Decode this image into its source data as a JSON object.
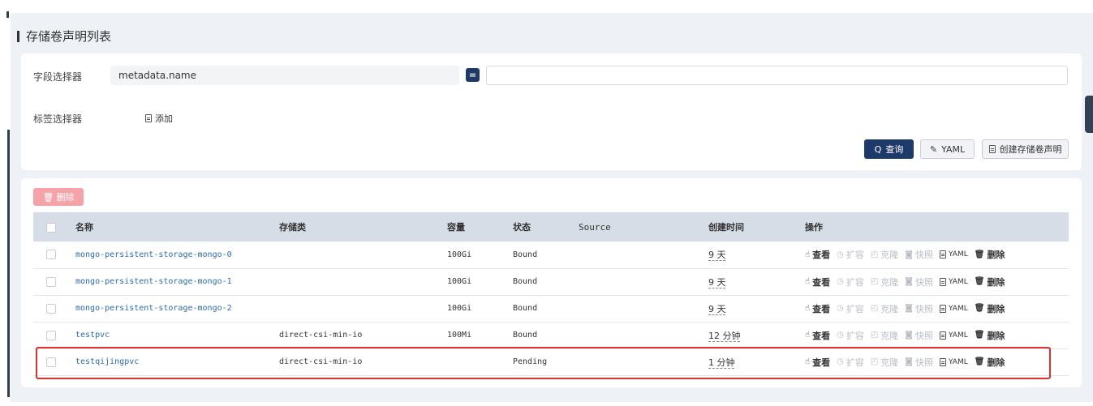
{
  "page": {
    "title": "存储卷声明列表"
  },
  "filters": {
    "field_selector_label": "字段选择器",
    "field_selector_value": "metadata.name",
    "operator": "=",
    "value_placeholder": "",
    "label_selector_label": "标签选择器",
    "add_label": "添加"
  },
  "actions": {
    "query": "查询",
    "yaml": "YAML",
    "create": "创建存储卷声明",
    "delete": "删除"
  },
  "table": {
    "columns": [
      "名称",
      "存储类",
      "容量",
      "状态",
      "Source",
      "创建时间",
      "操作"
    ],
    "rows": [
      {
        "name": "mongo-persistent-storage-mongo-0",
        "storage_class": "",
        "capacity": "100Gi",
        "status": "Bound",
        "source": "",
        "created": "9 天"
      },
      {
        "name": "mongo-persistent-storage-mongo-1",
        "storage_class": "",
        "capacity": "100Gi",
        "status": "Bound",
        "source": "",
        "created": "9 天"
      },
      {
        "name": "mongo-persistent-storage-mongo-2",
        "storage_class": "",
        "capacity": "100Gi",
        "status": "Bound",
        "source": "",
        "created": "9 天"
      },
      {
        "name": "testpvc",
        "storage_class": "direct-csi-min-io",
        "capacity": "100Mi",
        "status": "Bound",
        "source": "",
        "created": "12 分钟"
      },
      {
        "name": "testqijingpvc",
        "storage_class": "direct-csi-min-io",
        "capacity": "",
        "status": "Pending",
        "source": "",
        "created": "1 分钟"
      }
    ],
    "row_ops": {
      "view": "查看",
      "expand": "扩容",
      "clone": "克隆",
      "snapshot": "快照",
      "yaml": "YAML",
      "delete": "删除"
    }
  },
  "colors": {
    "primary": "#1e3a6b",
    "danger_light": "#f5a3a9",
    "highlight": "#e03131",
    "link": "#2b6cb0"
  }
}
